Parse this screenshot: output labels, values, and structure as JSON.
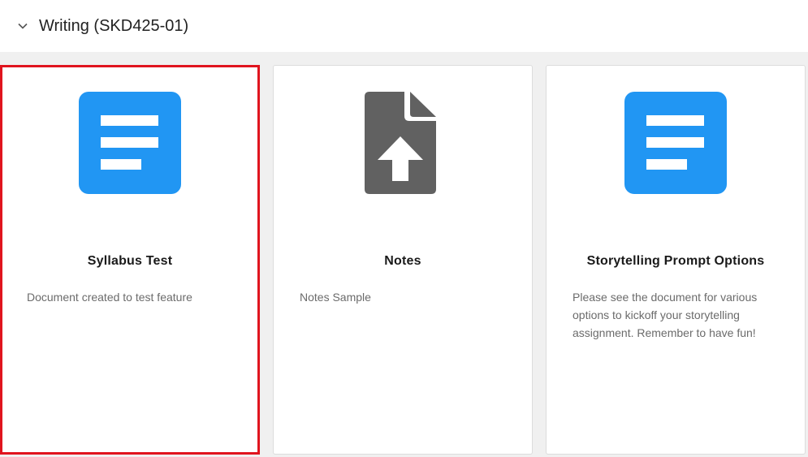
{
  "section": {
    "title": "Writing (SKD425-01)",
    "toggle_icon": "chevron-down-icon"
  },
  "cards": [
    {
      "title": "Syllabus Test",
      "description": "Document created to test feature",
      "icon": "document-icon",
      "icon_color": "#2196f3",
      "selected": true
    },
    {
      "title": "Notes",
      "description": "Notes Sample",
      "icon": "file-upload-icon",
      "icon_color": "#616161",
      "selected": false
    },
    {
      "title": "Storytelling Prompt Options",
      "description": "Please see the document for various options to kickoff your storytelling assignment. Remember to have fun!",
      "icon": "document-icon",
      "icon_color": "#2196f3",
      "selected": false
    }
  ],
  "colors": {
    "selection_border": "#e0141e",
    "background": "#f0f0f0"
  }
}
